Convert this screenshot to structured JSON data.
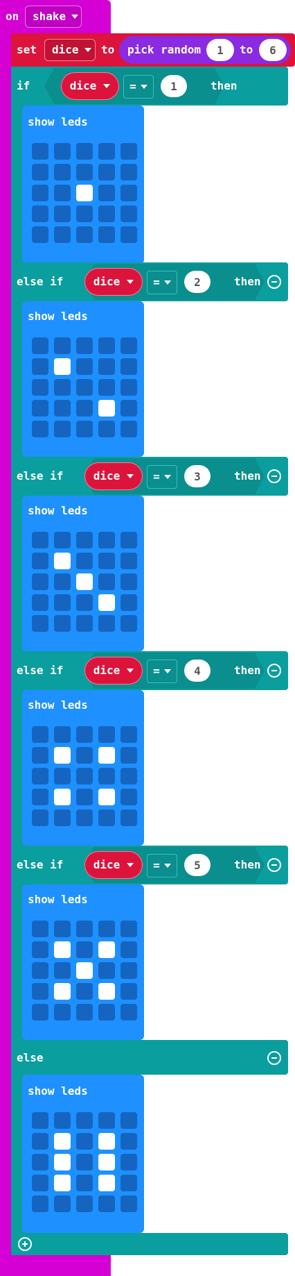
{
  "event": {
    "on_label": "on",
    "event_name": "shake"
  },
  "set_block": {
    "set_label": "set",
    "variable": "dice",
    "to_label": "to",
    "random": {
      "label": "pick random",
      "from": "1",
      "to_label": "to",
      "to": "6"
    }
  },
  "cond_labels": {
    "if": "if",
    "else_if": "else if",
    "then": "then",
    "else": "else",
    "eq": "="
  },
  "branches": [
    {
      "type": "if",
      "var": "dice",
      "op": "=",
      "value": "1",
      "show_leds_label": "show leds",
      "leds": [
        [
          0,
          0,
          0,
          0,
          0
        ],
        [
          0,
          0,
          0,
          0,
          0
        ],
        [
          0,
          0,
          1,
          0,
          0
        ],
        [
          0,
          0,
          0,
          0,
          0
        ],
        [
          0,
          0,
          0,
          0,
          0
        ]
      ]
    },
    {
      "type": "else_if",
      "var": "dice",
      "op": "=",
      "value": "2",
      "show_leds_label": "show leds",
      "leds": [
        [
          0,
          0,
          0,
          0,
          0
        ],
        [
          0,
          1,
          0,
          0,
          0
        ],
        [
          0,
          0,
          0,
          0,
          0
        ],
        [
          0,
          0,
          0,
          1,
          0
        ],
        [
          0,
          0,
          0,
          0,
          0
        ]
      ]
    },
    {
      "type": "else_if",
      "var": "dice",
      "op": "=",
      "value": "3",
      "show_leds_label": "show leds",
      "leds": [
        [
          0,
          0,
          0,
          0,
          0
        ],
        [
          0,
          1,
          0,
          0,
          0
        ],
        [
          0,
          0,
          1,
          0,
          0
        ],
        [
          0,
          0,
          0,
          1,
          0
        ],
        [
          0,
          0,
          0,
          0,
          0
        ]
      ]
    },
    {
      "type": "else_if",
      "var": "dice",
      "op": "=",
      "value": "4",
      "show_leds_label": "show leds",
      "leds": [
        [
          0,
          0,
          0,
          0,
          0
        ],
        [
          0,
          1,
          0,
          1,
          0
        ],
        [
          0,
          0,
          0,
          0,
          0
        ],
        [
          0,
          1,
          0,
          1,
          0
        ],
        [
          0,
          0,
          0,
          0,
          0
        ]
      ]
    },
    {
      "type": "else_if",
      "var": "dice",
      "op": "=",
      "value": "5",
      "show_leds_label": "show leds",
      "leds": [
        [
          0,
          0,
          0,
          0,
          0
        ],
        [
          0,
          1,
          0,
          1,
          0
        ],
        [
          0,
          0,
          1,
          0,
          0
        ],
        [
          0,
          1,
          0,
          1,
          0
        ],
        [
          0,
          0,
          0,
          0,
          0
        ]
      ]
    },
    {
      "type": "else",
      "show_leds_label": "show leds",
      "leds": [
        [
          0,
          0,
          0,
          0,
          0
        ],
        [
          0,
          1,
          0,
          1,
          0
        ],
        [
          0,
          1,
          0,
          1,
          0
        ],
        [
          0,
          1,
          0,
          1,
          0
        ],
        [
          0,
          0,
          0,
          0,
          0
        ]
      ]
    }
  ],
  "colors": {
    "event_purple": "#d400d4",
    "variable_red": "#dc143c",
    "logic_teal": "#0b9e9e",
    "basic_blue": "#1e90ff",
    "led_off": "#1565c0",
    "led_on": "#ffffff"
  },
  "icons": {
    "dropdown": "chevron-down-icon",
    "remove_branch": "minus-circle-icon",
    "add_branch": "plus-circle-icon"
  }
}
